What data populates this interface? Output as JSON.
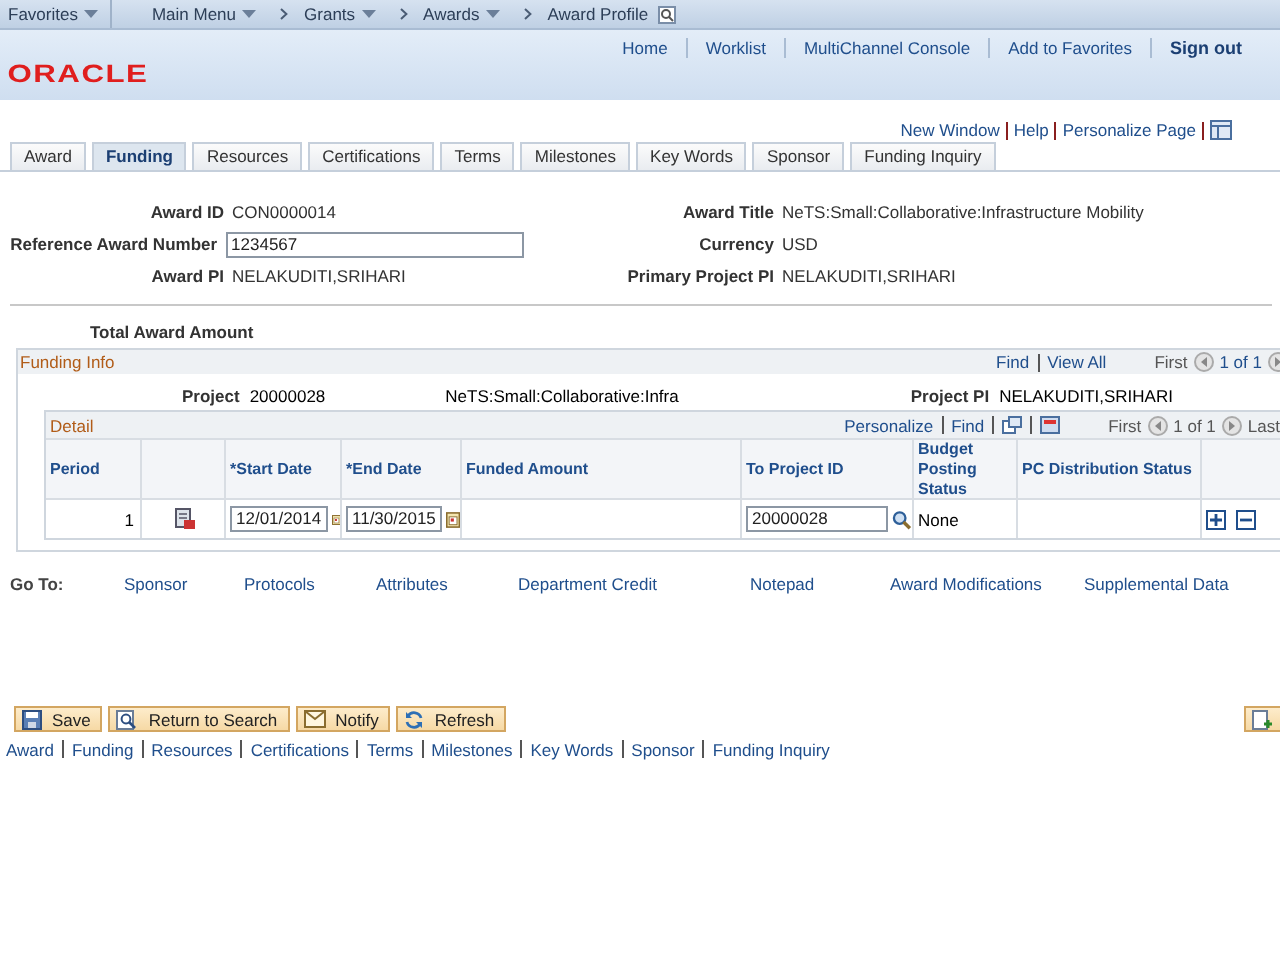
{
  "top_bar": {
    "items": [
      {
        "label": "Favorites",
        "kind": "menu"
      },
      {
        "label": "Main Menu",
        "kind": "menu"
      },
      {
        "label": "Grants",
        "kind": "crumb_menu"
      },
      {
        "label": "Awards",
        "kind": "crumb_menu"
      },
      {
        "label": "Award Profile",
        "kind": "crumb_current"
      }
    ]
  },
  "logo": "ORACLE",
  "header_links": [
    {
      "label": "Home",
      "kind": "link"
    },
    {
      "label": "Worklist",
      "kind": "link"
    },
    {
      "label": "MultiChannel Console",
      "kind": "link"
    },
    {
      "label": "Add to Favorites",
      "kind": "link"
    },
    {
      "label": "Sign out",
      "kind": "strong"
    }
  ],
  "page_links": [
    "New Window",
    "Help",
    "Personalize Page"
  ],
  "tabs": [
    {
      "label": "Award",
      "selected": false
    },
    {
      "label": "Funding",
      "selected": true
    },
    {
      "label": "Resources",
      "selected": false
    },
    {
      "label": "Certifications",
      "selected": false
    },
    {
      "label": "Terms",
      "selected": false
    },
    {
      "label": "Milestones",
      "selected": false
    },
    {
      "label": "Key Words",
      "selected": false
    },
    {
      "label": "Sponsor",
      "selected": false
    },
    {
      "label": "Funding Inquiry",
      "selected": false
    }
  ],
  "fields": [
    {
      "left": {
        "label": "Award ID",
        "value": "CON0000014",
        "kind": "text"
      },
      "right": {
        "label": "Award Title",
        "value": "NeTS:Small:Collaborative:Infrastructure Mobility"
      }
    },
    {
      "left": {
        "label": "Reference Award Number",
        "value": "1234567",
        "kind": "input"
      },
      "right": {
        "label": "Currency",
        "value": "USD"
      }
    },
    {
      "left": {
        "label": "Award PI",
        "value": "NELAKUDITI,SRIHARI",
        "kind": "text"
      },
      "right": {
        "label": "Primary Project PI",
        "value": "NELAKUDITI,SRIHARI"
      }
    }
  ],
  "total_award_amount_label": "Total Award Amount",
  "funding_info": {
    "title": "Funding Info",
    "find": "Find",
    "view_all": "View All",
    "first": "First",
    "count": "1 of 1",
    "project_label": "Project",
    "project_id": "20000028",
    "project_descr": "NeTS:Small:Collaborative:Infra",
    "project_pi_label": "Project PI",
    "project_pi": "NELAKUDITI,SRIHARI",
    "detail": {
      "title": "Detail",
      "personalize": "Personalize",
      "find": "Find",
      "first": "First",
      "count": "1 of 1",
      "last": "Last",
      "columns": [
        "Period",
        "*Start Date",
        "*End Date",
        "Funded Amount",
        "To Project ID",
        "Budget Posting Status",
        "PC Distribution Status"
      ],
      "rows": [
        {
          "period": "1",
          "start_date": "12/01/2014",
          "end_date": "11/30/2015",
          "to_project_id": "20000028",
          "budget_posting_status": "None"
        }
      ]
    }
  },
  "goto": {
    "label": "Go To:",
    "links": [
      "Sponsor",
      "Protocols",
      "Attributes",
      "Department Credit",
      "Notepad",
      "Award Modifications",
      "Supplemental Data"
    ]
  },
  "buttons": [
    {
      "label": "Save",
      "kind": "save"
    },
    {
      "label": "Return to Search",
      "kind": "search"
    },
    {
      "label": "Notify",
      "kind": "notify"
    },
    {
      "label": "Refresh",
      "kind": "refresh"
    }
  ],
  "footer_links": [
    "Award",
    "Funding",
    "Resources",
    "Certifications",
    "Terms",
    "Milestones",
    "Key Words",
    "Sponsor",
    "Funding Inquiry"
  ]
}
